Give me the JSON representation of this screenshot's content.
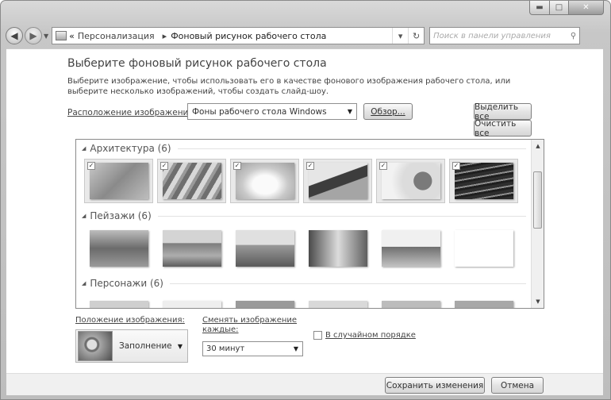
{
  "address": {
    "breadcrumb_prefix": "«",
    "crumb1": "Персонализация",
    "separator": "▸",
    "crumb2": "Фоновый рисунок рабочего стола",
    "search_placeholder": "Поиск в панели управления"
  },
  "main": {
    "title": "Выберите фоновый рисунок рабочего стола",
    "description": "Выберите изображение, чтобы использовать его в качестве фонового изображения рабочего стола, или выберите несколько изображений, чтобы создать слайд-шоу.",
    "location_label": "Расположение изображения:",
    "location_value": "Фоны рабочего стола Windows",
    "browse_button": "Обзор...",
    "select_all_button": "Выделить все",
    "clear_all_button": "Очистить все"
  },
  "gallery": {
    "groups": [
      {
        "title": "Архитектура (6)",
        "checked": [
          true,
          true,
          true,
          true,
          true,
          true
        ]
      },
      {
        "title": "Пейзажи (6)",
        "checked": [
          false,
          false,
          false,
          false,
          false,
          false
        ]
      },
      {
        "title": "Персонажи (6)",
        "checked": [
          false,
          false,
          false,
          false,
          false,
          false
        ]
      }
    ],
    "checkmark": "✓"
  },
  "position": {
    "label": "Положение изображения:",
    "value": "Заполнение"
  },
  "interval": {
    "label": "Сменять изображение каждые:",
    "value": "30 минут"
  },
  "shuffle": {
    "label": "В случайном порядке",
    "checked": false
  },
  "footer": {
    "save_button": "Сохранить изменения",
    "cancel_button": "Отмена"
  }
}
